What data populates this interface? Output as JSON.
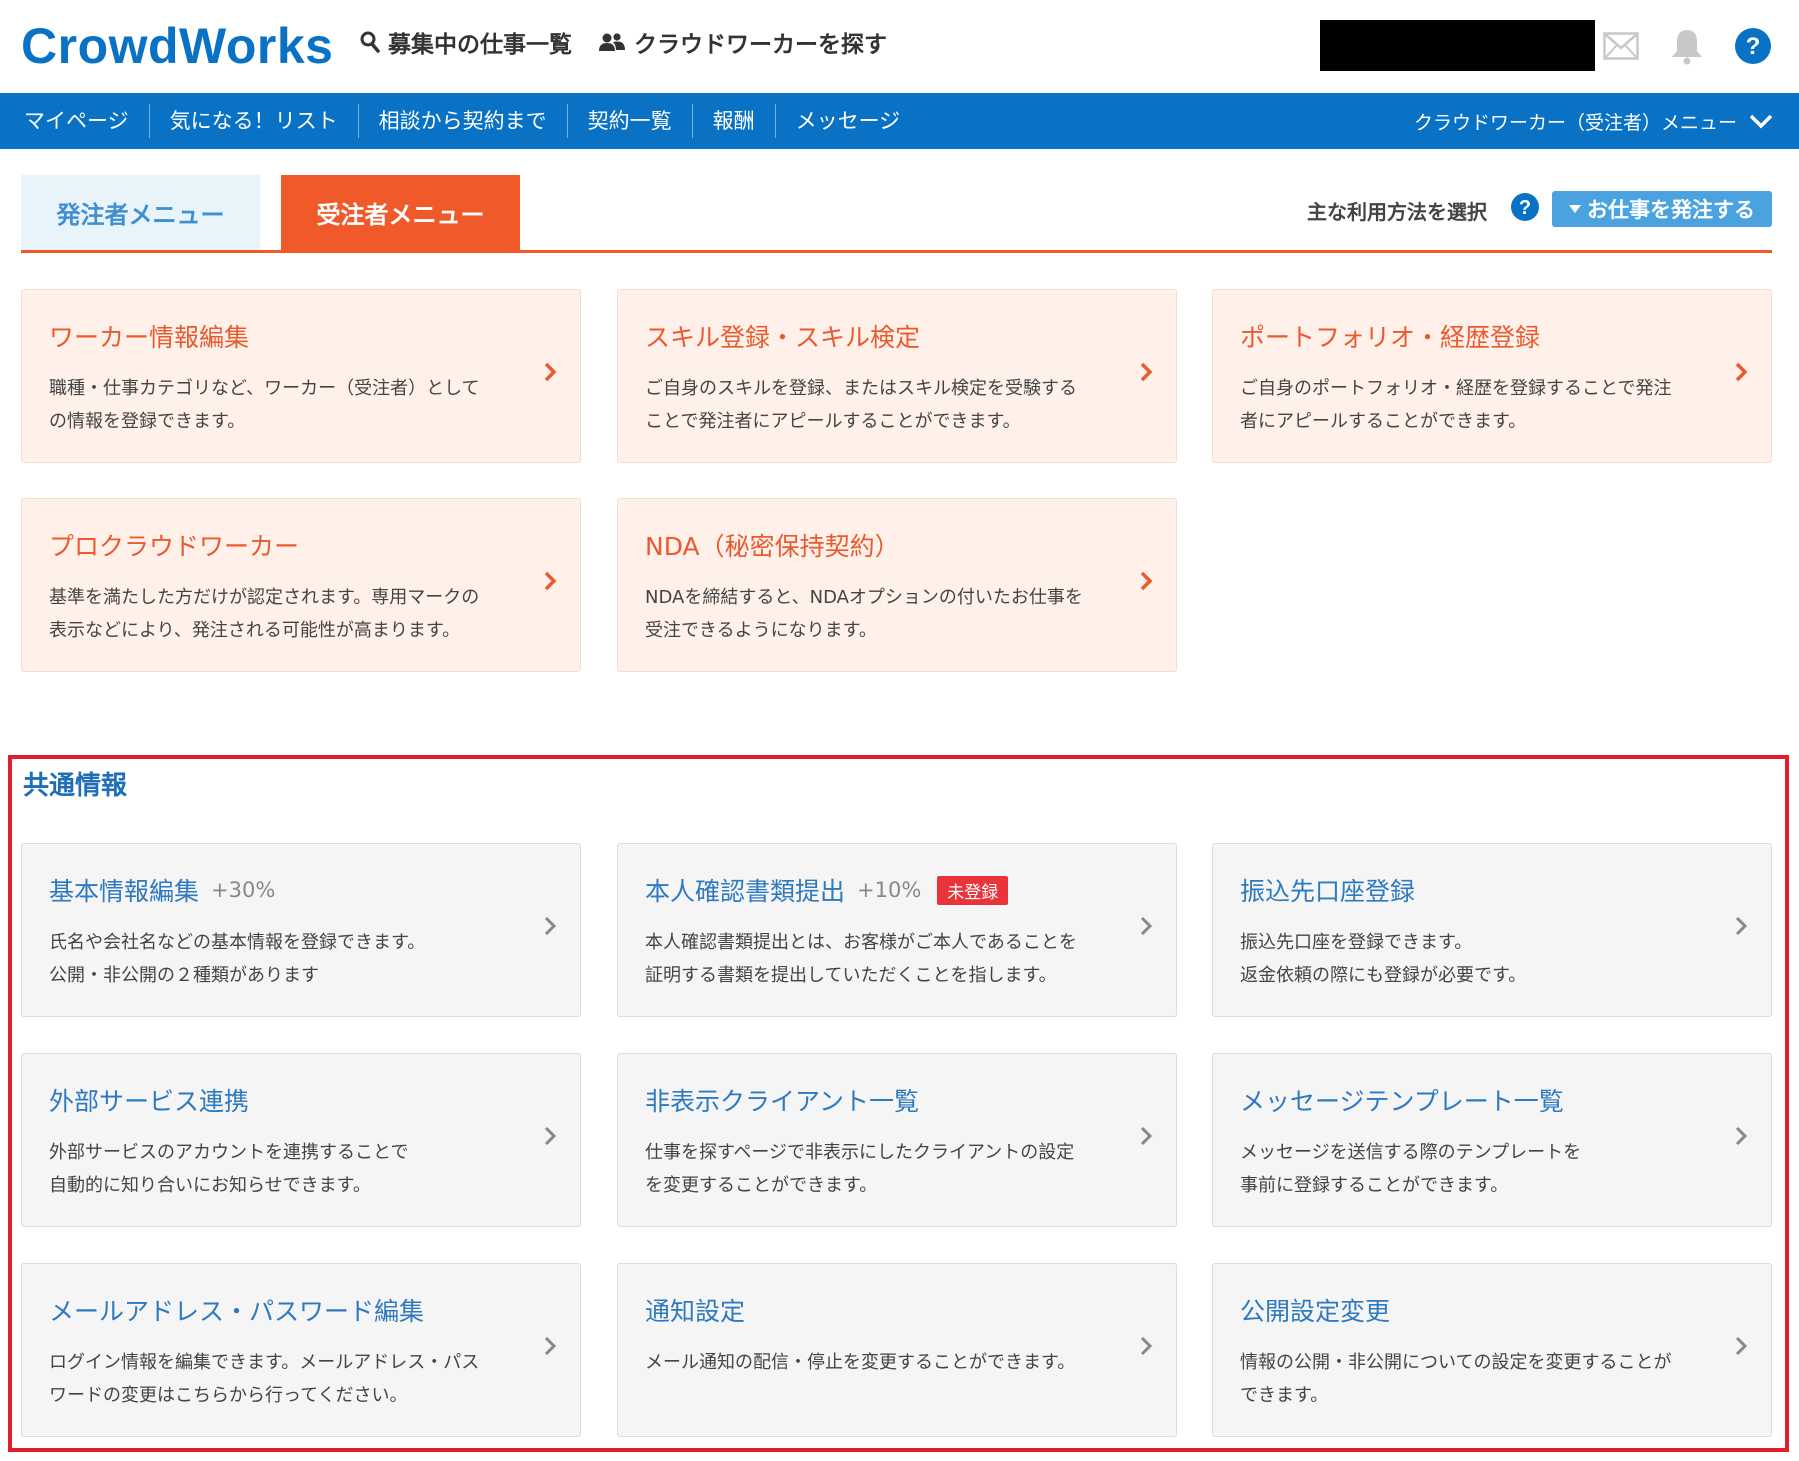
{
  "header": {
    "logo": "CrowdWorks",
    "nav_jobs": "募集中の仕事一覧",
    "nav_workers": "クラウドワーカーを探す",
    "icons": [
      "search-icon",
      "users-icon",
      "mail-icon",
      "bell-icon",
      "help-icon"
    ]
  },
  "navbar": {
    "items": [
      "マイページ",
      "気になる！リスト",
      "相談から契約まで",
      "契約一覧",
      "報酬",
      "メッセージ"
    ],
    "right_menu": "クラウドワーカー（受注者）メニュー"
  },
  "tabs": {
    "client": "発注者メニュー",
    "worker": "受注者メニュー",
    "usage_label": "主な利用方法を選択",
    "order_button": "お仕事を発注する"
  },
  "worker_cards": [
    {
      "title": "ワーカー情報編集",
      "desc1": "職種・仕事カテゴリなど、ワーカー（受注者）として",
      "desc2": "の情報を登録できます。"
    },
    {
      "title": "スキル登録・スキル検定",
      "desc1": "ご自身のスキルを登録、またはスキル検定を受験する",
      "desc2": "ことで発注者にアピールすることができます。"
    },
    {
      "title": "ポートフォリオ・経歴登録",
      "desc1": "ご自身のポートフォリオ・経歴を登録することで発注",
      "desc2": "者にアピールすることができます。"
    },
    {
      "title": "プロクラウドワーカー",
      "desc1": "基準を満たした方だけが認定されます。専用マークの",
      "desc2": "表示などにより、発注される可能性が高まります。"
    },
    {
      "title": "NDA（秘密保持契約）",
      "desc1": "NDAを締結すると、NDAオプションの付いたお仕事を",
      "desc2": "受注できるようになります。"
    }
  ],
  "common": {
    "section_title": "共通情報",
    "cards": [
      {
        "title": "基本情報編集",
        "pct": "+30%",
        "desc1": "氏名や会社名などの基本情報を登録できます。",
        "desc2": "公開・非公開の２種類があります"
      },
      {
        "title": "本人確認書類提出",
        "pct": "+10%",
        "badge": "未登録",
        "desc1": "本人確認書類提出とは、お客様がご本人であることを",
        "desc2": "証明する書類を提出していただくことを指します。"
      },
      {
        "title": "振込先口座登録",
        "desc1": "振込先口座を登録できます。",
        "desc2": "返金依頼の際にも登録が必要です。"
      },
      {
        "title": "外部サービス連携",
        "desc1": "外部サービスのアカウントを連携することで",
        "desc2": "自動的に知り合いにお知らせできます。"
      },
      {
        "title": "非表示クライアント一覧",
        "desc1": "仕事を探すページで非表示にしたクライアントの設定",
        "desc2": "を変更することができます。"
      },
      {
        "title": "メッセージテンプレート一覧",
        "desc1": "メッセージを送信する際のテンプレートを",
        "desc2": "事前に登録することができます。"
      },
      {
        "title": "メールアドレス・パスワード編集",
        "desc1": "ログイン情報を編集できます。メールアドレス・パス",
        "desc2": "ワードの変更はこちらから行ってください。"
      },
      {
        "title": "通知設定",
        "desc1": "メール通知の配信・停止を変更することができます。",
        "desc2": ""
      },
      {
        "title": "公開設定変更",
        "desc1": "情報の公開・非公開についての設定を変更することが",
        "desc2": "できます。"
      }
    ]
  },
  "colors": {
    "brand_blue": "#0a72c5",
    "accent_orange": "#f05a2b",
    "highlight_red": "#e11e2b"
  }
}
